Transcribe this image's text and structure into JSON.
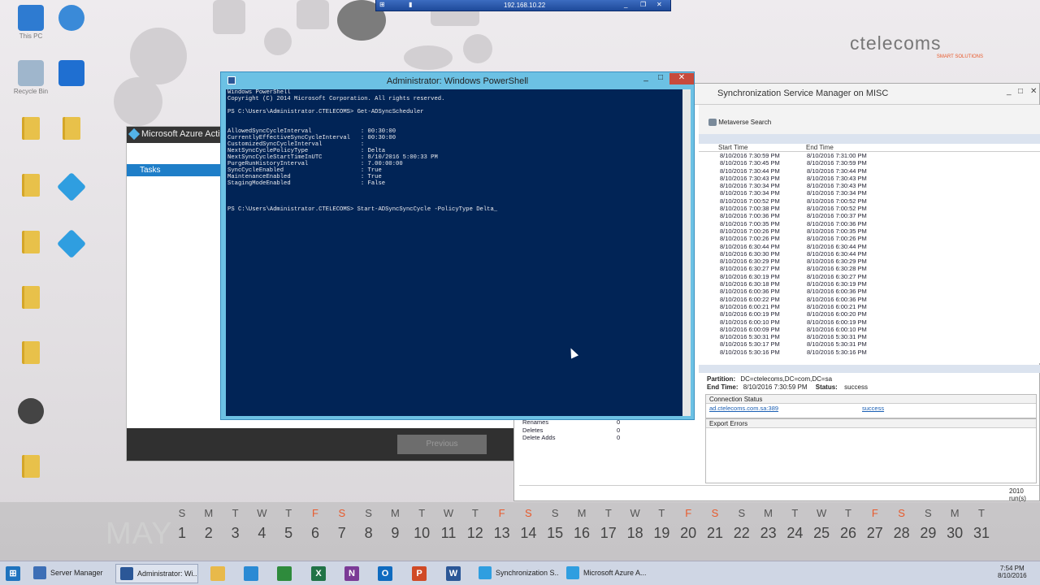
{
  "rdp_bar": {
    "title": "192.168.10.22"
  },
  "logo": {
    "brand": "ctelecoms",
    "tagline": "SMART SOLUTIONS"
  },
  "desktop_icons": [
    {
      "icon": "computer-icon",
      "label": "This PC"
    },
    {
      "icon": "browser-icon",
      "label": ""
    },
    {
      "icon": "recycle-bin-icon",
      "label": "Recycle Bin"
    },
    {
      "icon": "teamviewer-icon",
      "label": ""
    },
    {
      "icon": "folder-icon",
      "label": ""
    },
    {
      "icon": "folder-icon",
      "label": ""
    },
    {
      "icon": "folder-icon",
      "label": ""
    },
    {
      "icon": "azure-ad-connect-icon",
      "label": ""
    },
    {
      "icon": "folder-icon",
      "label": ""
    },
    {
      "icon": "azure-ad-connect-icon",
      "label": ""
    },
    {
      "icon": "folder-icon",
      "label": ""
    },
    {
      "icon": "folder-icon",
      "label": ""
    },
    {
      "icon": "disc-icon",
      "label": ""
    },
    {
      "icon": "folder-icon",
      "label": ""
    }
  ],
  "azure_window": {
    "title": "Microsoft Azure Active",
    "task": "Tasks",
    "previous_button": "Previous"
  },
  "powershell": {
    "title": "Administrator: Windows PowerShell",
    "lines": [
      "Windows PowerShell",
      "Copyright (C) 2014 Microsoft Corporation. All rights reserved.",
      "",
      "PS C:\\Users\\Administrator.CTELECOMS> Get-ADSyncScheduler",
      "",
      "",
      "AllowedSyncCycleInterval              : 00:30:00",
      "CurrentlyEffectiveSyncCycleInterval   : 00:30:00",
      "CustomizedSyncCycleInterval           :",
      "NextSyncCyclePolicyType               : Delta",
      "NextSyncCycleStartTimeInUTC           : 8/10/2016 5:00:33 PM",
      "PurgeRunHistoryInterval               : 7.00:00:00",
      "SyncCycleEnabled                      : True",
      "MaintenanceEnabled                    : True",
      "StagingModeEnabled                    : False",
      "",
      "",
      "",
      "PS C:\\Users\\Administrator.CTELECOMS> Start-ADSyncSyncCycle -PolicyType Delta_"
    ]
  },
  "sync_manager": {
    "title": "Synchronization Service Manager on MISC",
    "toolbar_button": "Metaverse Search",
    "col_start": "Start Time",
    "col_end": "End Time",
    "runs": [
      [
        "8/10/2016 7:30:59 PM",
        "8/10/2016 7:31:00 PM"
      ],
      [
        "8/10/2016 7:30:45 PM",
        "8/10/2016 7:30:59 PM"
      ],
      [
        "8/10/2016 7:30:44 PM",
        "8/10/2016 7:30:44 PM"
      ],
      [
        "8/10/2016 7:30:43 PM",
        "8/10/2016 7:30:43 PM"
      ],
      [
        "8/10/2016 7:30:34 PM",
        "8/10/2016 7:30:43 PM"
      ],
      [
        "8/10/2016 7:30:34 PM",
        "8/10/2016 7:30:34 PM"
      ],
      [
        "8/10/2016 7:00:52 PM",
        "8/10/2016 7:00:52 PM"
      ],
      [
        "8/10/2016 7:00:38 PM",
        "8/10/2016 7:00:52 PM"
      ],
      [
        "8/10/2016 7:00:36 PM",
        "8/10/2016 7:00:37 PM"
      ],
      [
        "8/10/2016 7:00:35 PM",
        "8/10/2016 7:00:36 PM"
      ],
      [
        "8/10/2016 7:00:26 PM",
        "8/10/2016 7:00:35 PM"
      ],
      [
        "8/10/2016 7:00:26 PM",
        "8/10/2016 7:00:26 PM"
      ],
      [
        "8/10/2016 6:30:44 PM",
        "8/10/2016 6:30:44 PM"
      ],
      [
        "8/10/2016 6:30:30 PM",
        "8/10/2016 6:30:44 PM"
      ],
      [
        "8/10/2016 6:30:29 PM",
        "8/10/2016 6:30:29 PM"
      ],
      [
        "8/10/2016 6:30:27 PM",
        "8/10/2016 6:30:28 PM"
      ],
      [
        "8/10/2016 6:30:19 PM",
        "8/10/2016 6:30:27 PM"
      ],
      [
        "8/10/2016 6:30:18 PM",
        "8/10/2016 6:30:19 PM"
      ],
      [
        "8/10/2016 6:00:36 PM",
        "8/10/2016 6:00:36 PM"
      ],
      [
        "8/10/2016 6:00:22 PM",
        "8/10/2016 6:00:36 PM"
      ],
      [
        "8/10/2016 6:00:21 PM",
        "8/10/2016 6:00:21 PM"
      ],
      [
        "8/10/2016 6:00:19 PM",
        "8/10/2016 6:00:20 PM"
      ],
      [
        "8/10/2016 6:00:10 PM",
        "8/10/2016 6:00:19 PM"
      ],
      [
        "8/10/2016 6:00:09 PM",
        "8/10/2016 6:00:10 PM"
      ],
      [
        "8/10/2016 5:30:31 PM",
        "8/10/2016 5:30:31 PM"
      ],
      [
        "8/10/2016 5:30:17 PM",
        "8/10/2016 5:30:31 PM"
      ],
      [
        "8/10/2016 5:30:16 PM",
        "8/10/2016 5:30:16 PM"
      ]
    ],
    "partition_label": "Partition:",
    "partition_value": "DC=ctelecoms,DC=com,DC=sa",
    "end_time_label": "End Time:",
    "end_time_value": "8/10/2016 7:30:59 PM",
    "status_label": "Status:",
    "status_value": "success",
    "connection_status_header": "Connection Status",
    "connection_server": "ad.ctelecoms.com.sa:389",
    "connection_result": "success",
    "export_errors_header": "Export Errors",
    "stats": [
      [
        "Renames",
        "0"
      ],
      [
        "Deletes",
        "0"
      ],
      [
        "Delete Adds",
        "0"
      ]
    ],
    "status_bar": "2010 run(s)"
  },
  "calendar": {
    "month": "MAY",
    "weekdays": [
      "S",
      "M",
      "T",
      "W",
      "T",
      "F",
      "S",
      "S",
      "M",
      "T",
      "W",
      "T",
      "F",
      "S",
      "S",
      "M",
      "T",
      "W",
      "T",
      "F",
      "S",
      "S",
      "M",
      "T",
      "W",
      "T",
      "F",
      "S",
      "S",
      "M",
      "T"
    ],
    "days": [
      "1",
      "2",
      "3",
      "4",
      "5",
      "6",
      "7",
      "8",
      "9",
      "10",
      "11",
      "12",
      "13",
      "14",
      "15",
      "16",
      "17",
      "18",
      "19",
      "20",
      "21",
      "22",
      "23",
      "24",
      "25",
      "26",
      "27",
      "28",
      "29",
      "30",
      "31"
    ],
    "weekend_color": "#e85a2c"
  },
  "taskbar": {
    "buttons": [
      {
        "label": "Server Manager",
        "icon": "server-manager-icon"
      },
      {
        "label": "Administrator: Wi...",
        "icon": "powershell-icon"
      },
      {
        "label": "Synchronization S...",
        "icon": "sync-manager-icon"
      },
      {
        "label": "Microsoft Azure A...",
        "icon": "azure-ad-connect-icon"
      }
    ],
    "pinned": [
      {
        "icon": "file-explorer-icon"
      },
      {
        "icon": "internet-explorer-icon"
      },
      {
        "icon": "project-icon"
      },
      {
        "icon": "excel-icon",
        "letter": "X"
      },
      {
        "icon": "onenote-icon",
        "letter": "N"
      },
      {
        "icon": "outlook-icon",
        "letter": "O"
      },
      {
        "icon": "powerpoint-icon",
        "letter": "P"
      },
      {
        "icon": "word-icon",
        "letter": "W"
      }
    ],
    "time": "7:54 PM",
    "date": "8/10/2016"
  }
}
